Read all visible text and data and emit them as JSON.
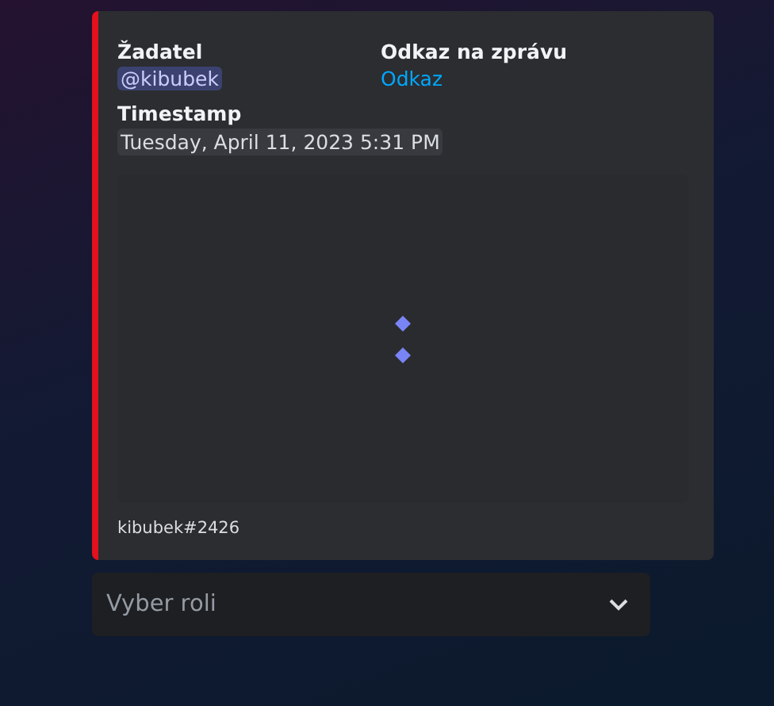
{
  "embed": {
    "fields": [
      {
        "name": "Žadatel",
        "value": "@kibubek",
        "kind": "mention",
        "inline": true
      },
      {
        "name": "Odkaz na zprávu",
        "value": "Odkaz",
        "kind": "link",
        "inline": true
      },
      {
        "name": "Timestamp",
        "value": "Tuesday, April 11, 2023 5:31 PM",
        "kind": "timestamp",
        "inline": false
      }
    ],
    "image": {
      "loading": true
    },
    "footer": "kibubek#2426"
  },
  "select": {
    "placeholder": "Vyber roli"
  }
}
